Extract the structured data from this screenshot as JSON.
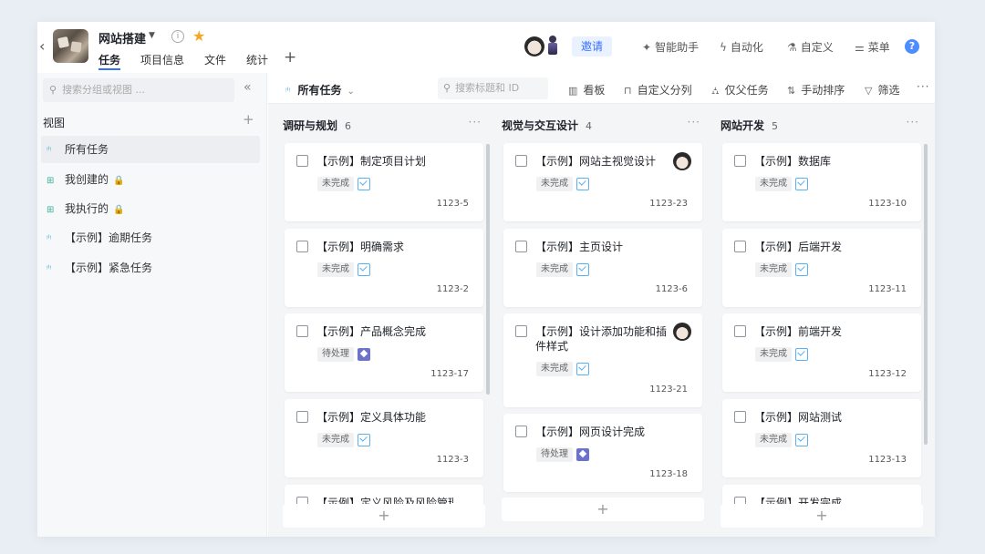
{
  "header": {
    "title": "网站搭建",
    "tabs": [
      "任务",
      "项目信息",
      "文件",
      "统计"
    ],
    "invite": "邀请",
    "actions": [
      {
        "icon": "magic-wand-icon",
        "label": "智能助手"
      },
      {
        "icon": "lightning-icon",
        "label": "自动化"
      },
      {
        "icon": "flask-icon",
        "label": "自定义"
      },
      {
        "icon": "menu-toggle-icon",
        "label": "菜单"
      }
    ],
    "help": "?"
  },
  "sidebar": {
    "search_placeholder": "搜索分组或视图 ...",
    "views_label": "视图",
    "items": [
      {
        "label": "所有任务",
        "icon": "list-icon",
        "locked": false,
        "active": true
      },
      {
        "label": "我创建的",
        "icon": "grid-icon",
        "locked": true
      },
      {
        "label": "我执行的",
        "icon": "grid-icon",
        "locked": true
      },
      {
        "label": "【示例】逾期任务",
        "icon": "list-icon",
        "locked": false
      },
      {
        "label": "【示例】紧急任务",
        "icon": "list-icon",
        "locked": false
      }
    ]
  },
  "toolbar": {
    "view": "所有任务",
    "search_placeholder": "搜索标题和 ID",
    "buttons": [
      "看板",
      "自定义分列",
      "仅父任务",
      "手动排序",
      "筛选"
    ]
  },
  "columns": [
    {
      "title": "调研与规划",
      "count": "6",
      "cards": [
        {
          "title": "【示例】制定项目计划",
          "status": "未完成",
          "type": "task",
          "id": "1123-5"
        },
        {
          "title": "【示例】明确需求",
          "status": "未完成",
          "type": "task",
          "id": "1123-2"
        },
        {
          "title": "【示例】产品概念完成",
          "status": "待处理",
          "type": "milestone",
          "id": "1123-17"
        },
        {
          "title": "【示例】定义具体功能",
          "status": "未完成",
          "type": "task",
          "id": "1123-3"
        },
        {
          "title": "【示例】定义风险及风险管理办法",
          "status": "",
          "type": "task",
          "id": ""
        }
      ]
    },
    {
      "title": "视觉与交互设计",
      "count": "4",
      "cards": [
        {
          "title": "【示例】网站主视觉设计",
          "status": "未完成",
          "type": "task",
          "id": "1123-23",
          "avatar": true
        },
        {
          "title": "【示例】主页设计",
          "status": "未完成",
          "type": "task",
          "id": "1123-6"
        },
        {
          "title": "【示例】设计添加功能和插件样式",
          "status": "未完成",
          "type": "task",
          "id": "1123-21",
          "avatar": true
        },
        {
          "title": "【示例】网页设计完成",
          "status": "待处理",
          "type": "milestone",
          "id": "1123-18"
        }
      ]
    },
    {
      "title": "网站开发",
      "count": "5",
      "cards": [
        {
          "title": "【示例】数据库",
          "status": "未完成",
          "type": "task",
          "id": "1123-10"
        },
        {
          "title": "【示例】后端开发",
          "status": "未完成",
          "type": "task",
          "id": "1123-11"
        },
        {
          "title": "【示例】前端开发",
          "status": "未完成",
          "type": "task",
          "id": "1123-12"
        },
        {
          "title": "【示例】网站测试",
          "status": "未完成",
          "type": "task",
          "id": "1123-13"
        },
        {
          "title": "【示例】开发完成",
          "status": "",
          "type": "task",
          "id": ""
        }
      ]
    }
  ]
}
